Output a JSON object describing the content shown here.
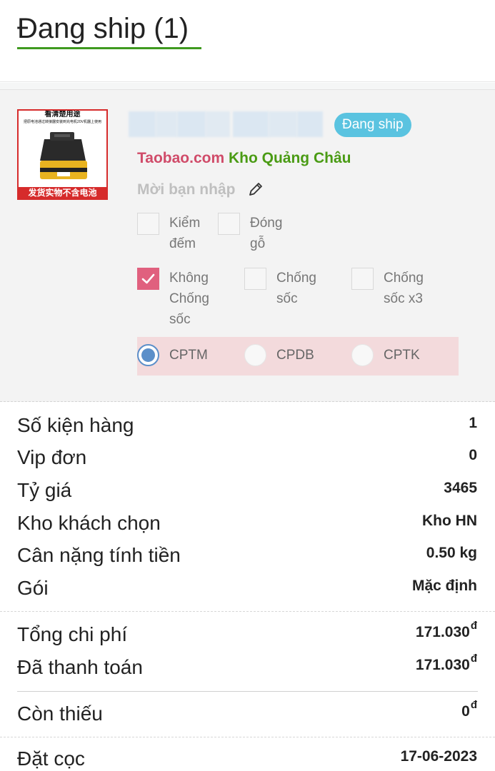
{
  "header": {
    "title": "Đang ship (1)"
  },
  "item": {
    "image_text_top": "看清楚用途",
    "image_text_sub": "把原电池通过转接器安装到充电机20V机器上使用",
    "image_text_bottom": "发货实物不含电池",
    "status": "Đang ship",
    "site": "Taobao.com",
    "warehouse": "Kho Quảng Châu",
    "note_placeholder": "Mời bạn nhập",
    "options": [
      {
        "label_l1": "Kiểm",
        "label_l2": "đếm",
        "label_l3": "",
        "checked": false
      },
      {
        "label_l1": "Đóng",
        "label_l2": "gỗ",
        "label_l3": "",
        "checked": false
      },
      {
        "label_l1": "Không",
        "label_l2": "Chống",
        "label_l3": "sốc",
        "checked": true
      },
      {
        "label_l1": "Chống",
        "label_l2": "sốc",
        "label_l3": "",
        "checked": false
      },
      {
        "label_l1": "Chống",
        "label_l2": "sốc x3",
        "label_l3": "",
        "checked": false
      }
    ],
    "shipping_methods": [
      {
        "label": "CPTM",
        "selected": true
      },
      {
        "label": "CPDB",
        "selected": false
      },
      {
        "label": "CPTK",
        "selected": false
      }
    ]
  },
  "summary": {
    "rows": [
      {
        "label": "Số kiện hàng",
        "value": "1"
      },
      {
        "label": "Vip đơn",
        "value": "0"
      },
      {
        "label": "Tỷ giá",
        "value": "3465"
      },
      {
        "label": "Kho khách chọn",
        "value": "Kho HN"
      },
      {
        "label": "Cân nặng tính tiền",
        "value": "0.50 kg"
      },
      {
        "label": "Gói",
        "value": "Mặc định"
      }
    ],
    "total_label": "Tổng chi phí",
    "total_value": "171.030",
    "paid_label": "Đã thanh toán",
    "paid_value": "171.030",
    "remaining_label": "Còn thiếu",
    "remaining_value": "0",
    "currency": "đ",
    "deposit_label": "Đặt cọc",
    "deposit_value": "17-06-2023"
  },
  "colors": {
    "accent_green": "#3f9a1f",
    "badge_blue": "#5ac3e0",
    "site_pink": "#d04b69",
    "warehouse_green": "#4a9b14",
    "checkbox_pink": "#e0607e",
    "radio_blue": "#5b8fc9",
    "radio_row_bg": "#f3dadc"
  }
}
